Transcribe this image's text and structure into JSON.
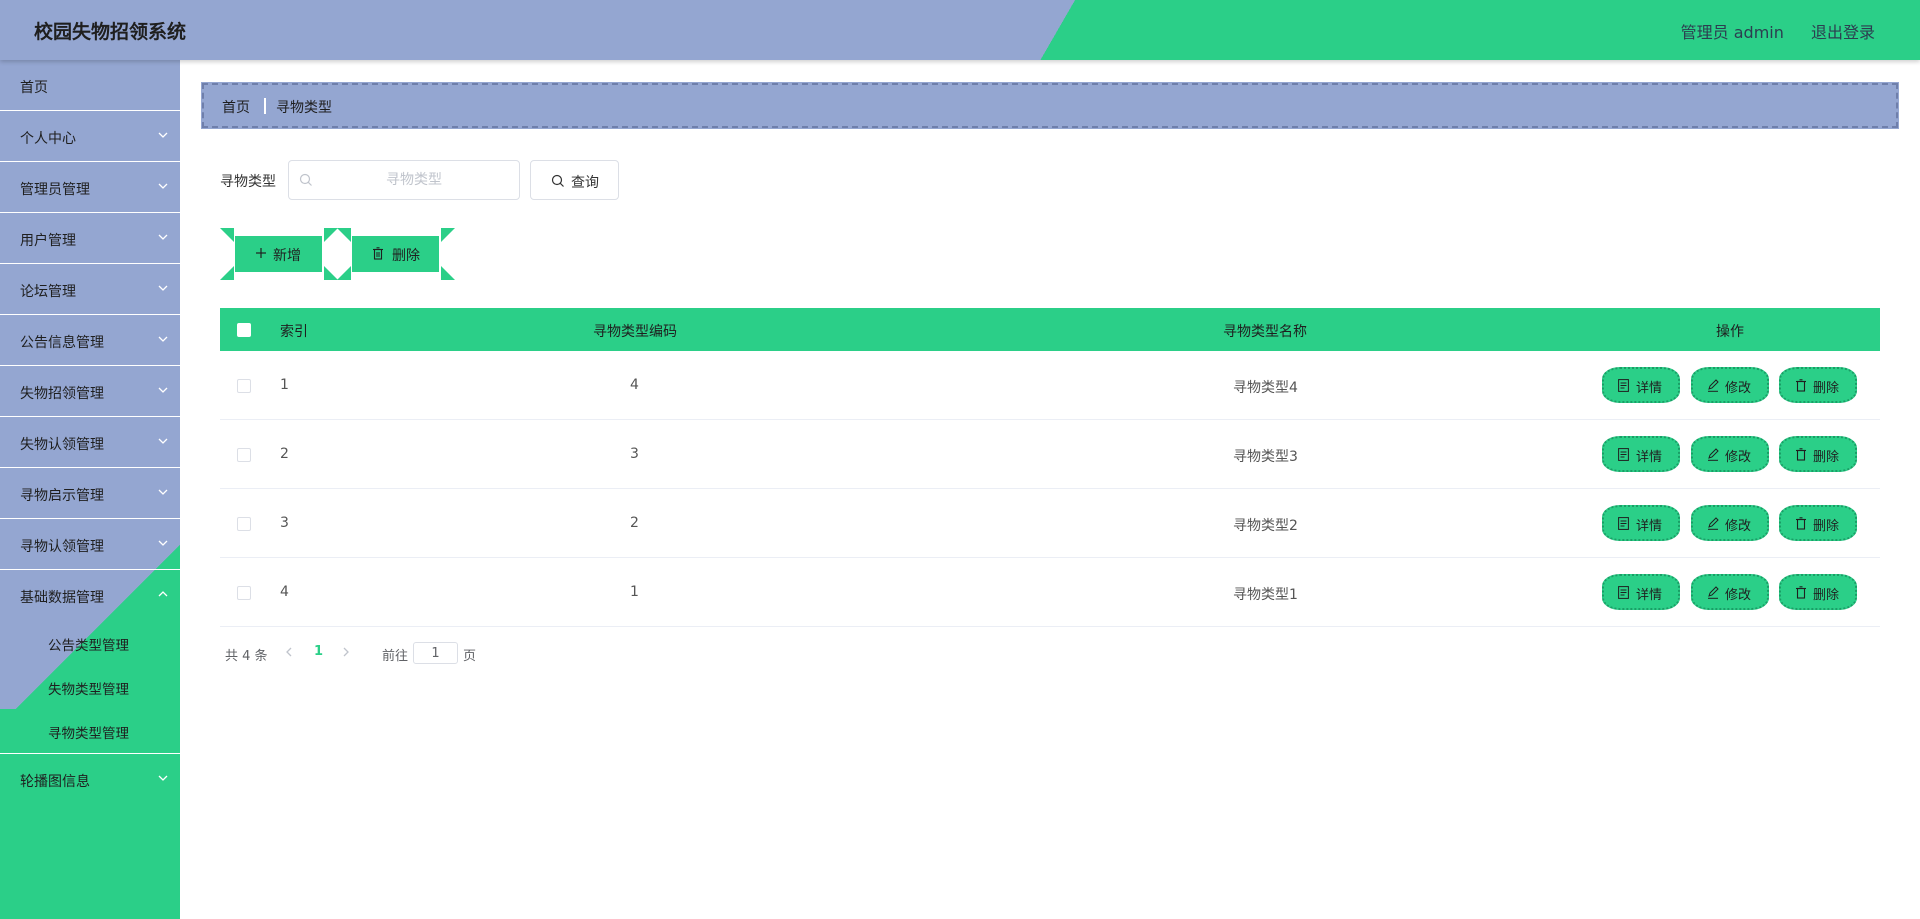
{
  "header": {
    "title": "校园失物招领系统",
    "admin_label": "管理员 admin",
    "logout_label": "退出登录"
  },
  "sidebar": {
    "items": [
      {
        "label": "首页"
      },
      {
        "label": "个人中心"
      },
      {
        "label": "管理员管理"
      },
      {
        "label": "用户管理"
      },
      {
        "label": "论坛管理"
      },
      {
        "label": "公告信息管理"
      },
      {
        "label": "失物招领管理"
      },
      {
        "label": "失物认领管理"
      },
      {
        "label": "寻物启示管理"
      },
      {
        "label": "寻物认领管理"
      },
      {
        "label": "基础数据管理"
      }
    ],
    "sub_items": [
      {
        "label": "公告类型管理"
      },
      {
        "label": "失物类型管理"
      },
      {
        "label": "寻物类型管理"
      }
    ],
    "last_item": {
      "label": "轮播图信息"
    }
  },
  "breadcrumb": {
    "home": "首页",
    "current": "寻物类型"
  },
  "search": {
    "label": "寻物类型",
    "placeholder": "寻物类型",
    "query_label": "查询"
  },
  "actions": {
    "add_label": "新增",
    "delete_label": "删除"
  },
  "table": {
    "headers": {
      "index": "索引",
      "code": "寻物类型编码",
      "name": "寻物类型名称",
      "ops": "操作"
    },
    "rows": [
      {
        "index": "1",
        "code": "4",
        "name": "寻物类型4"
      },
      {
        "index": "2",
        "code": "3",
        "name": "寻物类型3"
      },
      {
        "index": "3",
        "code": "2",
        "name": "寻物类型2"
      },
      {
        "index": "4",
        "code": "1",
        "name": "寻物类型1"
      }
    ],
    "ops": {
      "detail": "详情",
      "edit": "修改",
      "delete": "删除"
    }
  },
  "pagination": {
    "total_text": "共 4 条",
    "current_page": "1",
    "goto_label": "前往",
    "goto_value": "1",
    "page_unit": "页"
  },
  "colors": {
    "primary": "#2bcf88",
    "secondary": "#94a6d1"
  }
}
